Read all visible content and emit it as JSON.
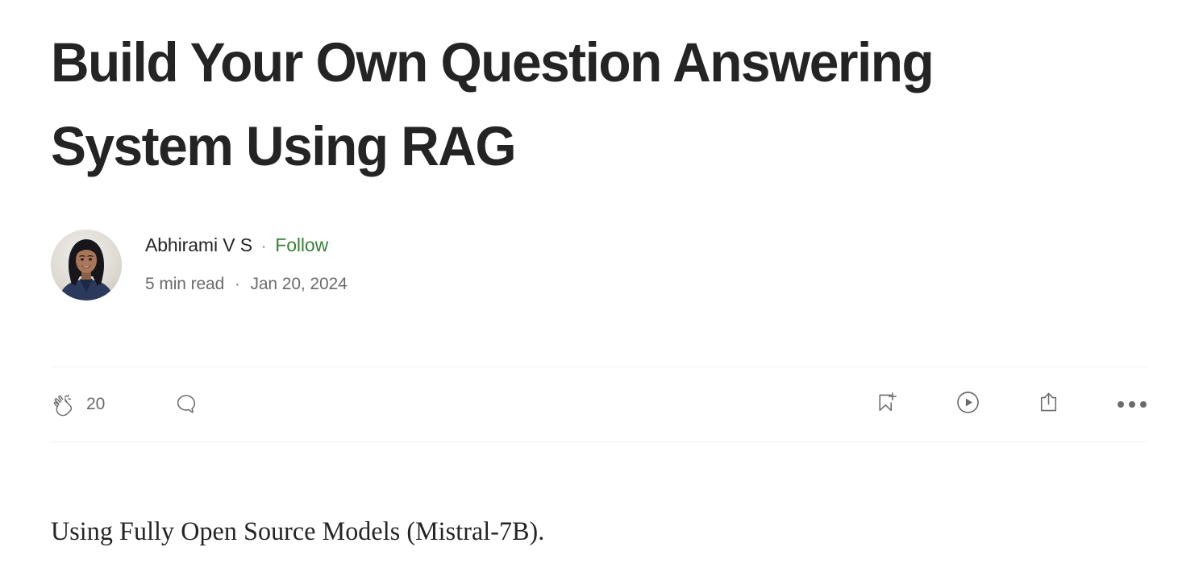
{
  "article": {
    "title": "Build Your Own Question Answering System Using RAG",
    "body_text": "Using Fully Open Source Models (Mistral-7B)."
  },
  "byline": {
    "author_name": "Abhirami V S",
    "separator": "·",
    "follow_label": "Follow",
    "read_time": "5 min read",
    "publish_date": "Jan 20, 2024",
    "avatar_alt": "author-avatar"
  },
  "actions": {
    "clap_icon": "clap-icon",
    "clap_count": "20",
    "comment_icon": "comment-icon",
    "bookmark_icon": "bookmark-add-icon",
    "listen_icon": "play-circle-icon",
    "share_icon": "share-icon",
    "more_icon": "more-options-icon"
  },
  "colors": {
    "text_primary": "#242424",
    "text_secondary": "#6b6b6b",
    "follow_green": "#39813a",
    "divider": "#f2f2f2",
    "background": "#ffffff"
  }
}
